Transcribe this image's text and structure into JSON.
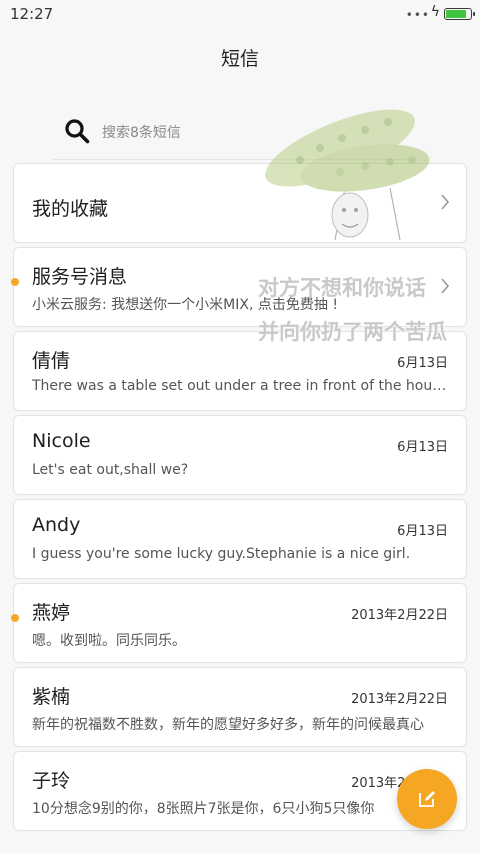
{
  "status_bar": {
    "time": "12:27",
    "battery_level": 0.9
  },
  "header": {
    "title": "短信"
  },
  "search": {
    "placeholder": "搜索8条短信"
  },
  "favorites": {
    "label": "我的收藏"
  },
  "conversations": [
    {
      "name": "服务号消息",
      "date": "",
      "preview": "小米云服务: 我想送你一个小米MIX, 点击免费抽 !",
      "unread": true
    },
    {
      "name": "倩倩",
      "date": "6月13日",
      "preview": "There was a table set out under a tree in front of the house",
      "unread": false
    },
    {
      "name": "Nicole",
      "date": "6月13日",
      "preview": "Let's eat out,shall we?",
      "unread": false
    },
    {
      "name": "Andy",
      "date": "6月13日",
      "preview": "I guess you're some lucky guy.Stephanie is a nice girl.",
      "unread": false
    },
    {
      "name": "燕婷",
      "date": "2013年2月22日",
      "preview": "嗯。收到啦。同乐同乐。",
      "unread": true
    },
    {
      "name": "紫楠",
      "date": "2013年2月22日",
      "preview": "新年的祝福数不胜数，新年的愿望好多好多，新年的问候最真心",
      "unread": false
    },
    {
      "name": "子玲",
      "date": "2013年2月22日",
      "preview": "10分想念9别的你，8张照片7张是你，6只小狗5只像你",
      "unread": false
    }
  ],
  "sticker": {
    "line1": "对方不想和你说话",
    "line2": "并向你扔了两个苦瓜"
  },
  "colors": {
    "accent": "#f5a623",
    "battery": "#3ec63e"
  },
  "icons": {
    "search": "search-icon",
    "chevron": "chevron-right-icon",
    "compose": "compose-icon"
  }
}
